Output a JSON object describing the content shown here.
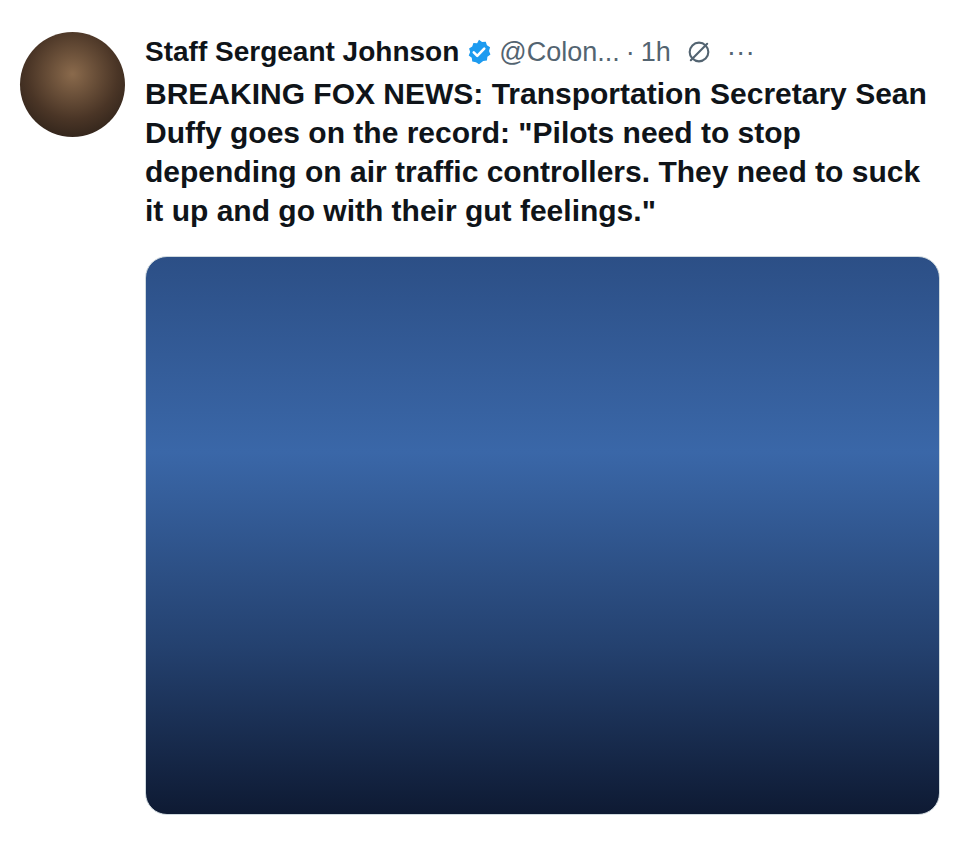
{
  "post": {
    "author": {
      "name": "Staff Sergeant Johnson",
      "verified": true,
      "handle": "@Colon...",
      "separator": "·",
      "time": "1h"
    },
    "menu": "···",
    "text": "BREAKING FOX NEWS: Transportation Secretary Sean Duffy goes on the record: \"Pilots need to stop depending on air traffic controllers. They need to suck it up and go with their gut feelings.\""
  }
}
